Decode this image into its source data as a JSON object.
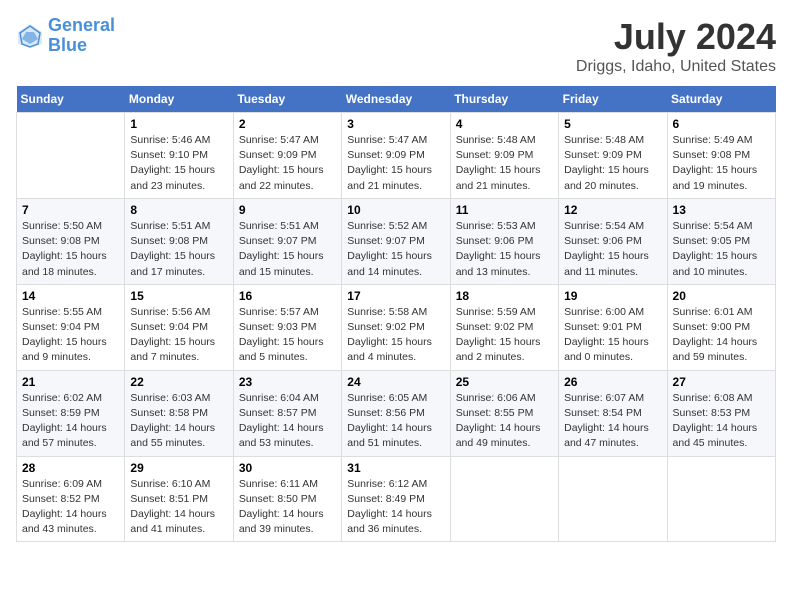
{
  "header": {
    "logo_line1": "General",
    "logo_line2": "Blue",
    "title": "July 2024",
    "subtitle": "Driggs, Idaho, United States"
  },
  "calendar": {
    "days_of_week": [
      "Sunday",
      "Monday",
      "Tuesday",
      "Wednesday",
      "Thursday",
      "Friday",
      "Saturday"
    ],
    "weeks": [
      [
        {
          "day": "",
          "info": ""
        },
        {
          "day": "1",
          "info": "Sunrise: 5:46 AM\nSunset: 9:10 PM\nDaylight: 15 hours\nand 23 minutes."
        },
        {
          "day": "2",
          "info": "Sunrise: 5:47 AM\nSunset: 9:09 PM\nDaylight: 15 hours\nand 22 minutes."
        },
        {
          "day": "3",
          "info": "Sunrise: 5:47 AM\nSunset: 9:09 PM\nDaylight: 15 hours\nand 21 minutes."
        },
        {
          "day": "4",
          "info": "Sunrise: 5:48 AM\nSunset: 9:09 PM\nDaylight: 15 hours\nand 21 minutes."
        },
        {
          "day": "5",
          "info": "Sunrise: 5:48 AM\nSunset: 9:09 PM\nDaylight: 15 hours\nand 20 minutes."
        },
        {
          "day": "6",
          "info": "Sunrise: 5:49 AM\nSunset: 9:08 PM\nDaylight: 15 hours\nand 19 minutes."
        }
      ],
      [
        {
          "day": "7",
          "info": "Sunrise: 5:50 AM\nSunset: 9:08 PM\nDaylight: 15 hours\nand 18 minutes."
        },
        {
          "day": "8",
          "info": "Sunrise: 5:51 AM\nSunset: 9:08 PM\nDaylight: 15 hours\nand 17 minutes."
        },
        {
          "day": "9",
          "info": "Sunrise: 5:51 AM\nSunset: 9:07 PM\nDaylight: 15 hours\nand 15 minutes."
        },
        {
          "day": "10",
          "info": "Sunrise: 5:52 AM\nSunset: 9:07 PM\nDaylight: 15 hours\nand 14 minutes."
        },
        {
          "day": "11",
          "info": "Sunrise: 5:53 AM\nSunset: 9:06 PM\nDaylight: 15 hours\nand 13 minutes."
        },
        {
          "day": "12",
          "info": "Sunrise: 5:54 AM\nSunset: 9:06 PM\nDaylight: 15 hours\nand 11 minutes."
        },
        {
          "day": "13",
          "info": "Sunrise: 5:54 AM\nSunset: 9:05 PM\nDaylight: 15 hours\nand 10 minutes."
        }
      ],
      [
        {
          "day": "14",
          "info": "Sunrise: 5:55 AM\nSunset: 9:04 PM\nDaylight: 15 hours\nand 9 minutes."
        },
        {
          "day": "15",
          "info": "Sunrise: 5:56 AM\nSunset: 9:04 PM\nDaylight: 15 hours\nand 7 minutes."
        },
        {
          "day": "16",
          "info": "Sunrise: 5:57 AM\nSunset: 9:03 PM\nDaylight: 15 hours\nand 5 minutes."
        },
        {
          "day": "17",
          "info": "Sunrise: 5:58 AM\nSunset: 9:02 PM\nDaylight: 15 hours\nand 4 minutes."
        },
        {
          "day": "18",
          "info": "Sunrise: 5:59 AM\nSunset: 9:02 PM\nDaylight: 15 hours\nand 2 minutes."
        },
        {
          "day": "19",
          "info": "Sunrise: 6:00 AM\nSunset: 9:01 PM\nDaylight: 15 hours\nand 0 minutes."
        },
        {
          "day": "20",
          "info": "Sunrise: 6:01 AM\nSunset: 9:00 PM\nDaylight: 14 hours\nand 59 minutes."
        }
      ],
      [
        {
          "day": "21",
          "info": "Sunrise: 6:02 AM\nSunset: 8:59 PM\nDaylight: 14 hours\nand 57 minutes."
        },
        {
          "day": "22",
          "info": "Sunrise: 6:03 AM\nSunset: 8:58 PM\nDaylight: 14 hours\nand 55 minutes."
        },
        {
          "day": "23",
          "info": "Sunrise: 6:04 AM\nSunset: 8:57 PM\nDaylight: 14 hours\nand 53 minutes."
        },
        {
          "day": "24",
          "info": "Sunrise: 6:05 AM\nSunset: 8:56 PM\nDaylight: 14 hours\nand 51 minutes."
        },
        {
          "day": "25",
          "info": "Sunrise: 6:06 AM\nSunset: 8:55 PM\nDaylight: 14 hours\nand 49 minutes."
        },
        {
          "day": "26",
          "info": "Sunrise: 6:07 AM\nSunset: 8:54 PM\nDaylight: 14 hours\nand 47 minutes."
        },
        {
          "day": "27",
          "info": "Sunrise: 6:08 AM\nSunset: 8:53 PM\nDaylight: 14 hours\nand 45 minutes."
        }
      ],
      [
        {
          "day": "28",
          "info": "Sunrise: 6:09 AM\nSunset: 8:52 PM\nDaylight: 14 hours\nand 43 minutes."
        },
        {
          "day": "29",
          "info": "Sunrise: 6:10 AM\nSunset: 8:51 PM\nDaylight: 14 hours\nand 41 minutes."
        },
        {
          "day": "30",
          "info": "Sunrise: 6:11 AM\nSunset: 8:50 PM\nDaylight: 14 hours\nand 39 minutes."
        },
        {
          "day": "31",
          "info": "Sunrise: 6:12 AM\nSunset: 8:49 PM\nDaylight: 14 hours\nand 36 minutes."
        },
        {
          "day": "",
          "info": ""
        },
        {
          "day": "",
          "info": ""
        },
        {
          "day": "",
          "info": ""
        }
      ]
    ]
  }
}
